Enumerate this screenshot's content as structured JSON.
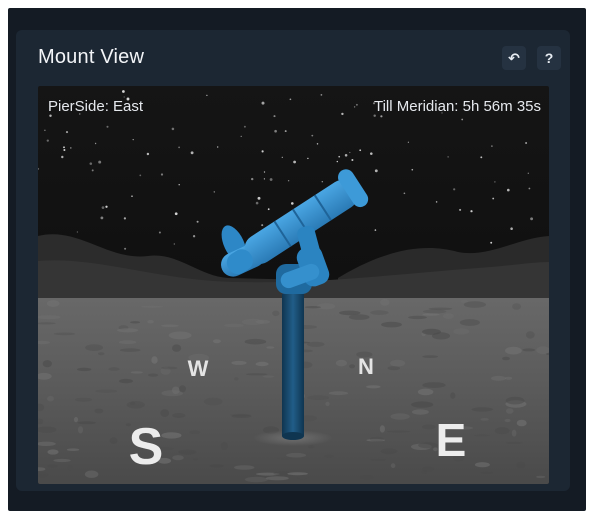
{
  "panel": {
    "title": "Mount View",
    "reset_icon": "undo-icon",
    "reset_glyph": "↶",
    "help_icon": "help-icon",
    "help_glyph": "?"
  },
  "view": {
    "pier_side": "PierSide: East",
    "till_meridian": "Till Meridian: 5h 56m 35s",
    "compass": {
      "west": "W",
      "north": "N",
      "south": "S",
      "east": "E"
    }
  },
  "colors": {
    "telescope": "#3a93d1",
    "pier": "#1a4f75",
    "sky": "#0f0f10",
    "ground": "#5b5b5b"
  }
}
